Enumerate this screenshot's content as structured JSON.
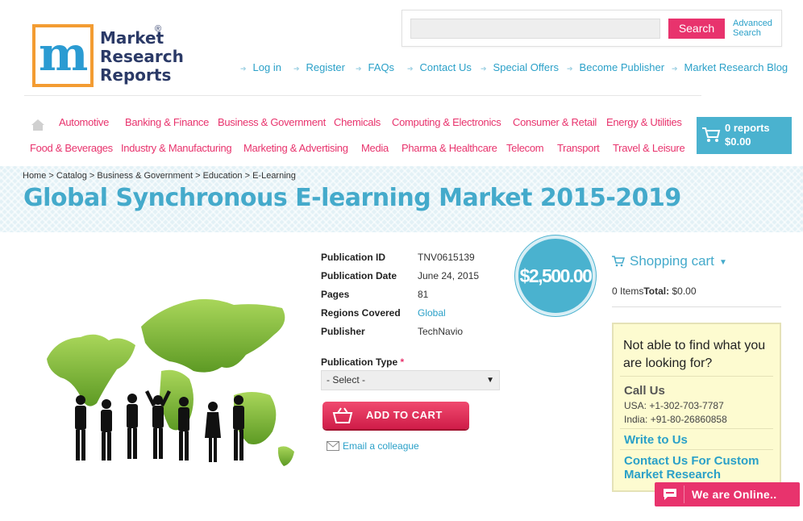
{
  "logo": {
    "lines": [
      "Market",
      "Research",
      "Reports"
    ],
    "registered": "®",
    "letter": "m"
  },
  "search": {
    "placeholder": "",
    "button_label": "Search",
    "advanced_label": "Advanced Search"
  },
  "top_links": [
    "Log in",
    "Register",
    "FAQs",
    "Contact Us",
    "Special Offers",
    "Become Publisher",
    "Market Research Blog"
  ],
  "categories_row1": [
    "Automotive",
    "Banking & Finance",
    "Business & Government",
    "Chemicals",
    "Computing & Electronics",
    "Consumer & Retail",
    "Energy & Utilities"
  ],
  "categories_row2": [
    "Food & Beverages",
    "Industry & Manufacturing",
    "Marketing & Advertising",
    "Media",
    "Pharma & Healthcare",
    "Telecom",
    "Transport",
    "Travel & Leisure"
  ],
  "cart_button": {
    "count_label": "0 reports",
    "total_label": "$0.00"
  },
  "breadcrumb": [
    "Home",
    "Catalog",
    "Business & Government",
    "Education",
    "E-Learning"
  ],
  "breadcrumb_sep": ">",
  "page_title": "Global Synchronous E-learning Market 2015-2019",
  "details": [
    {
      "label": "Publication ID",
      "value": "TNV0615139"
    },
    {
      "label": "Publication Date",
      "value": "June 24, 2015"
    },
    {
      "label": "Pages",
      "value": "81"
    },
    {
      "label": "Regions Covered",
      "value": "Global"
    },
    {
      "label": "Publisher",
      "value": "TechNavio"
    }
  ],
  "price": "$2,500.00",
  "publication_type": {
    "label": "Publication Type",
    "required_mark": "*",
    "selected": "- Select -"
  },
  "add_to_cart_label": "ADD TO CART",
  "email_colleague_label": "Email a colleague",
  "shopping_cart": {
    "title": "Shopping cart",
    "items_label": "0 Items",
    "total_label": "Total:",
    "total_value": "$0.00"
  },
  "help_box": {
    "question": "Not able to find what you are looking for?",
    "call_us": "Call Us",
    "usa_phone": "USA: +1-302-703-7787",
    "india_phone": "India: +91-80-26860858",
    "write_to_us": "Write to Us",
    "custom_research": "Contact Us For Custom Market Research"
  },
  "online_chat_label": "We are Online..",
  "colors": {
    "accent_pink": "#e8336d",
    "accent_teal": "#44aacb",
    "cart_blue": "#4ab2cf",
    "help_bg": "#fdfbd0"
  }
}
